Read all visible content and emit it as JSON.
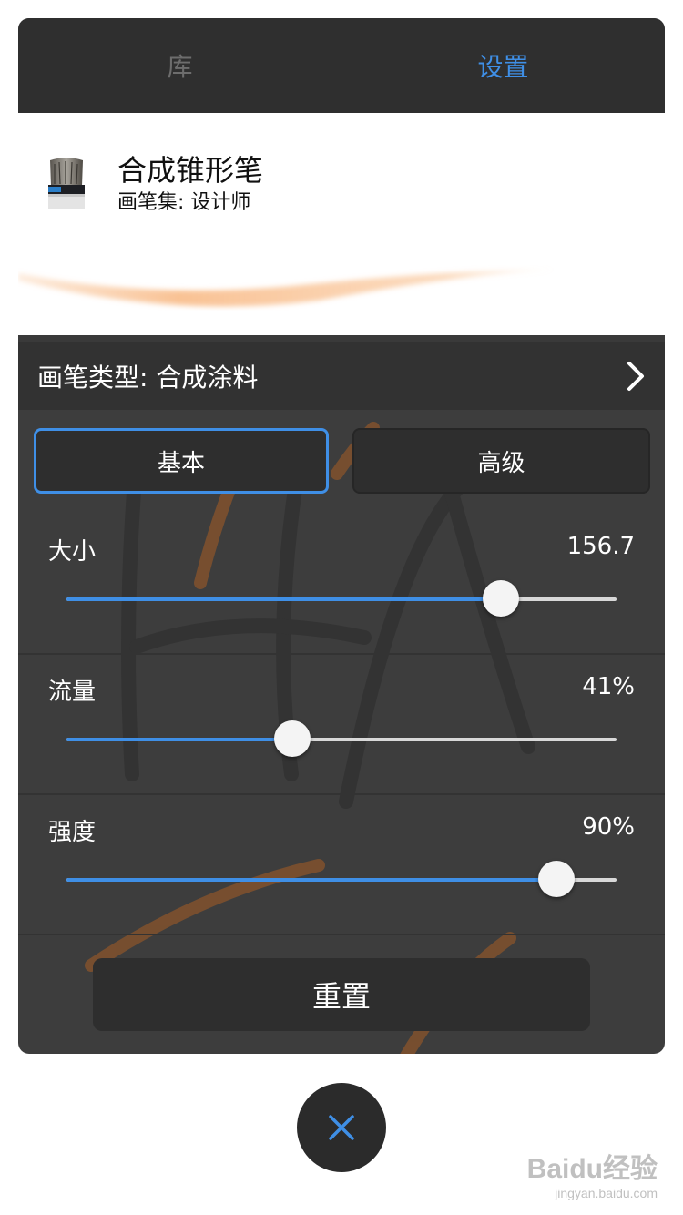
{
  "tabs": [
    {
      "label": "库",
      "active": false
    },
    {
      "label": "设置",
      "active": true
    }
  ],
  "brush": {
    "name": "合成锥形笔",
    "set": "画笔集: 设计师",
    "icon": "brush-icon"
  },
  "brush_type": {
    "label": "画笔类型: 合成涂料",
    "icon": "chevron-right-icon"
  },
  "segments": {
    "basic": "基本",
    "advanced": "高级",
    "selected": "基本"
  },
  "sliders": [
    {
      "label": "大小",
      "value_text": "156.7",
      "fraction": 0.79
    },
    {
      "label": "流量",
      "value_text": "41%",
      "fraction": 0.41
    },
    {
      "label": "强度",
      "value_text": "90%",
      "fraction": 0.89
    }
  ],
  "reset_label": "重置",
  "close_icon": "close-icon",
  "watermark": {
    "main": "Baidu经验",
    "sub": "jingyan.baidu.com"
  },
  "colors": {
    "accent": "#3f8fe6",
    "panel": "#3d3d3d",
    "tab_bar": "#2f2f2f",
    "stroke": "#f7b37a"
  }
}
